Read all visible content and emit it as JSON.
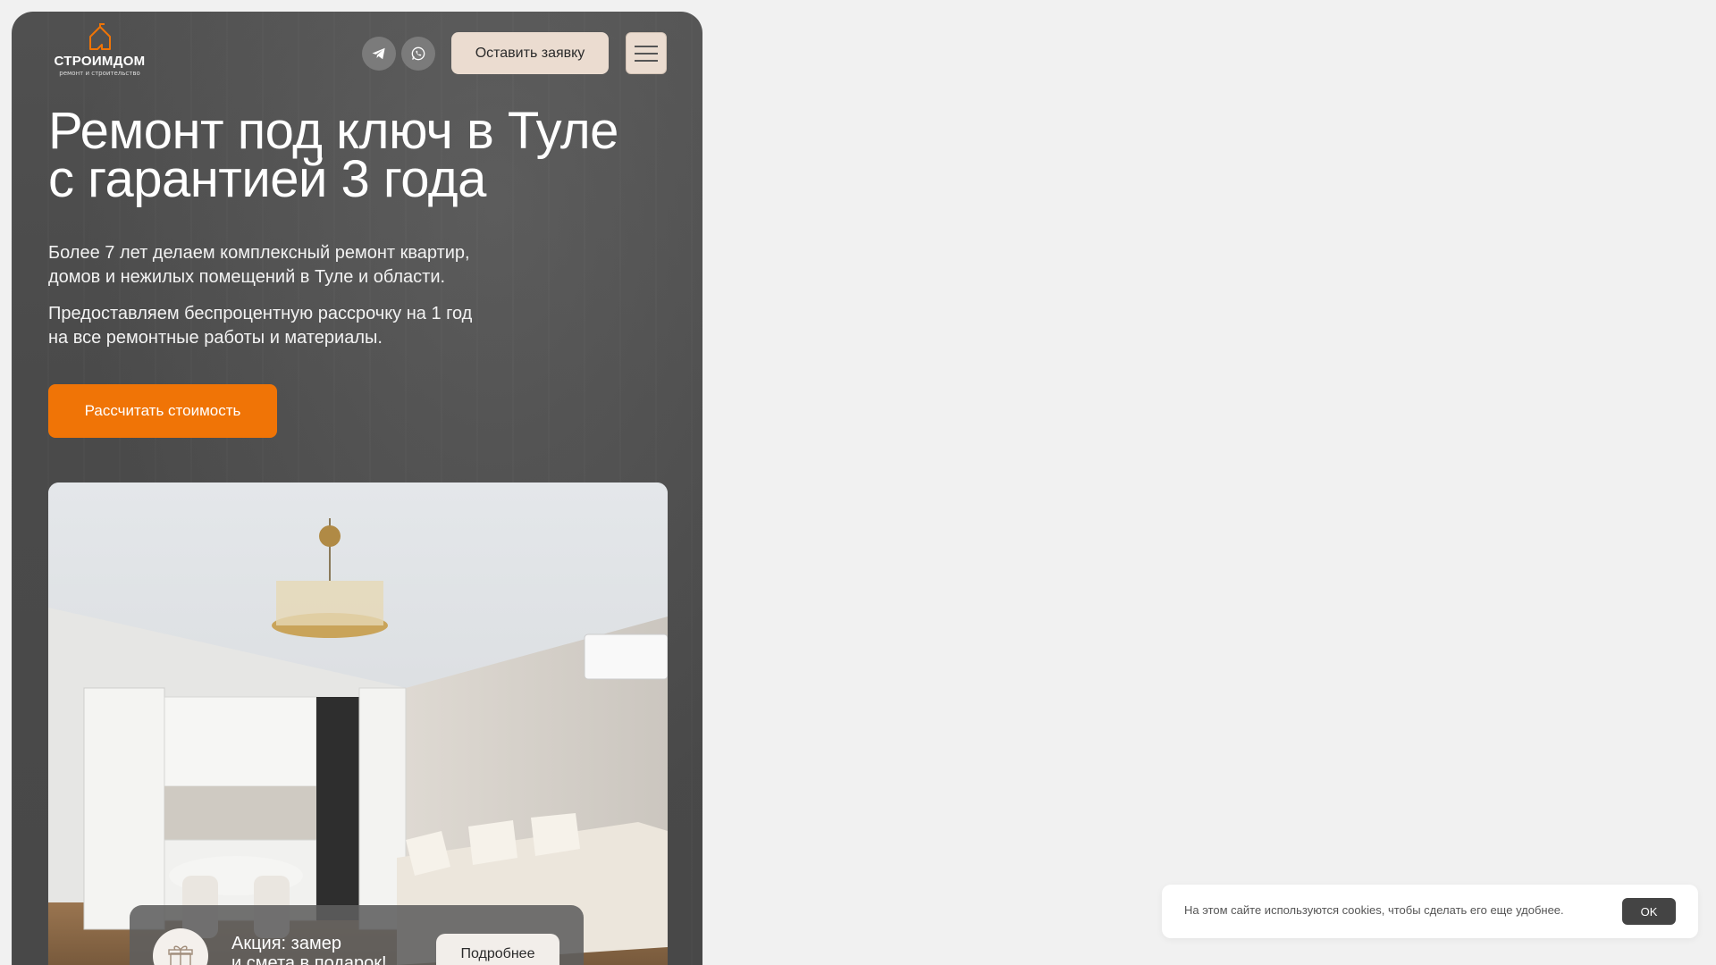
{
  "brand": {
    "name": "СТРОИМДОМ",
    "tagline": "ремонт и строительство",
    "accent_color": "#f07406",
    "beige_color": "#ebdcd0"
  },
  "header": {
    "social": [
      {
        "icon": "telegram-icon"
      },
      {
        "icon": "whatsapp-icon"
      }
    ],
    "request_button": "Оставить заявку",
    "menu_icon": "hamburger-menu-icon"
  },
  "hero": {
    "title_line1": "Ремонт под ключ в Туле",
    "title_line2": "с гарантией 3 года",
    "lead1_line1": "Более 7 лет делаем комплексный ремонт квартир,",
    "lead1_line2": "домов и нежилых помещений в Туле и области.",
    "lead2_line1": "Предоставляем беспроцентную рассрочку на 1 год",
    "lead2_line2": "на все ремонтные работы и материалы.",
    "cta_button": "Рассчитать стоимость"
  },
  "promo": {
    "icon": "gift-icon",
    "text_line1": "Акция: замер",
    "text_line2": "и смета в подарок!",
    "button": "Подробнее"
  },
  "cookie": {
    "text": "На этом сайте используются cookies, чтобы сделать его еще удобнее.",
    "ok_button": "OK"
  }
}
